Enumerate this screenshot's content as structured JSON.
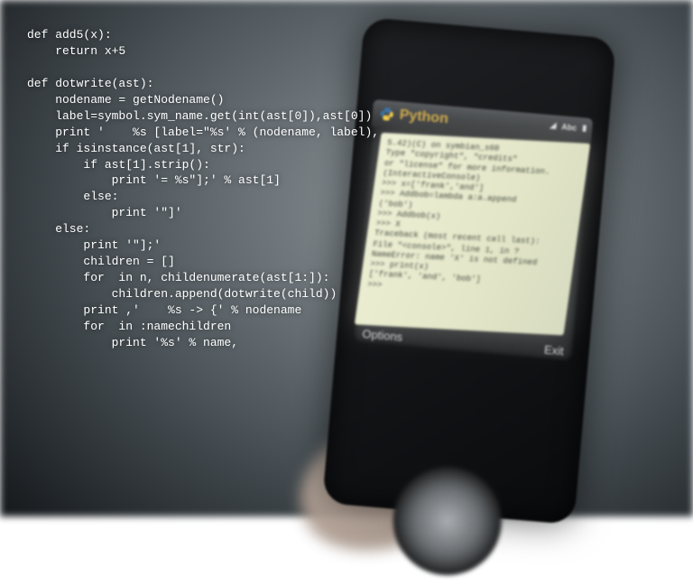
{
  "overlay_code": "def add5(x):\n    return x+5\n\ndef dotwrite(ast):\n    nodename = getNodename()\n    label=symbol.sym_name.get(int(ast[0]),ast[0])\n    print '    %s [label=\"%s' % (nodename, label),\n    if isinstance(ast[1], str):\n        if ast[1].strip():\n            print '= %s\"];' % ast[1]\n        else:\n            print '\"]'\n    else:\n        print '\"];'\n        children = []\n        for  in n, childenumerate(ast[1:]):\n            children.append(dotwrite(child))\n        print ,'    %s -> {' % nodename\n        for  in :namechildren\n            print '%s' % name,",
  "phone": {
    "title": "Python",
    "softkeys": {
      "left": "Options",
      "right": "Exit"
    },
    "status": {
      "signal": "◢",
      "abc": "Abc",
      "battery": "▮"
    },
    "console_lines": [
      "5.42)(C) on symbian_s60",
      "Type \"copyright\", \"credits\"",
      "or \"license\" for more information.",
      "(InteractiveConsole)",
      ">>> x=['frank','and']",
      ">>> Addbob=lambda a:a.append",
      "('bob')",
      ">>> Addbob(x)",
      ">>> X",
      "Traceback (most recent call last):",
      "  File \"<console>\", line 1, in ?",
      "NameError: name 'X' is not defined",
      ">>> print(x)",
      "['frank', 'and', 'bob']",
      ">>>"
    ]
  }
}
